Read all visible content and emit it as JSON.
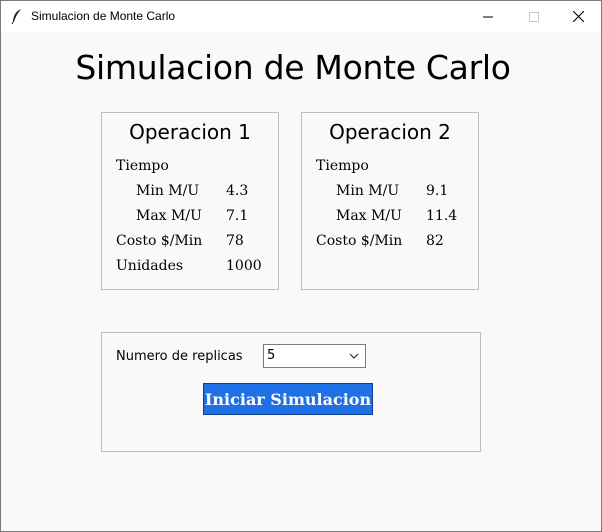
{
  "window": {
    "title": "Simulacion de Monte Carlo",
    "icon": "feather-icon",
    "controls": [
      "minimize-icon",
      "maximize-icon",
      "close-icon"
    ]
  },
  "main_title": "Simulacion de Monte Carlo",
  "operacion1": {
    "title": "Operacion 1",
    "tiempo_label": "Tiempo",
    "min_label": "Min M/U",
    "min_value": "4.3",
    "max_label": "Max M/U",
    "max_value": "7.1",
    "costo_label": "Costo $/Min",
    "costo_value": "78",
    "unidades_label": "Unidades",
    "unidades_value": "1000"
  },
  "operacion2": {
    "title": "Operacion 2",
    "tiempo_label": "Tiempo",
    "min_label": "Min M/U",
    "min_value": "9.1",
    "max_label": "Max M/U",
    "max_value": "11.4",
    "costo_label": "Costo $/Min",
    "costo_value": "82"
  },
  "simulacion": {
    "replicas_label": "Numero de replicas",
    "replicas_value": "5",
    "start_button_label": "Iniciar Simulacion",
    "start_button_color": "#1f6fe5"
  }
}
